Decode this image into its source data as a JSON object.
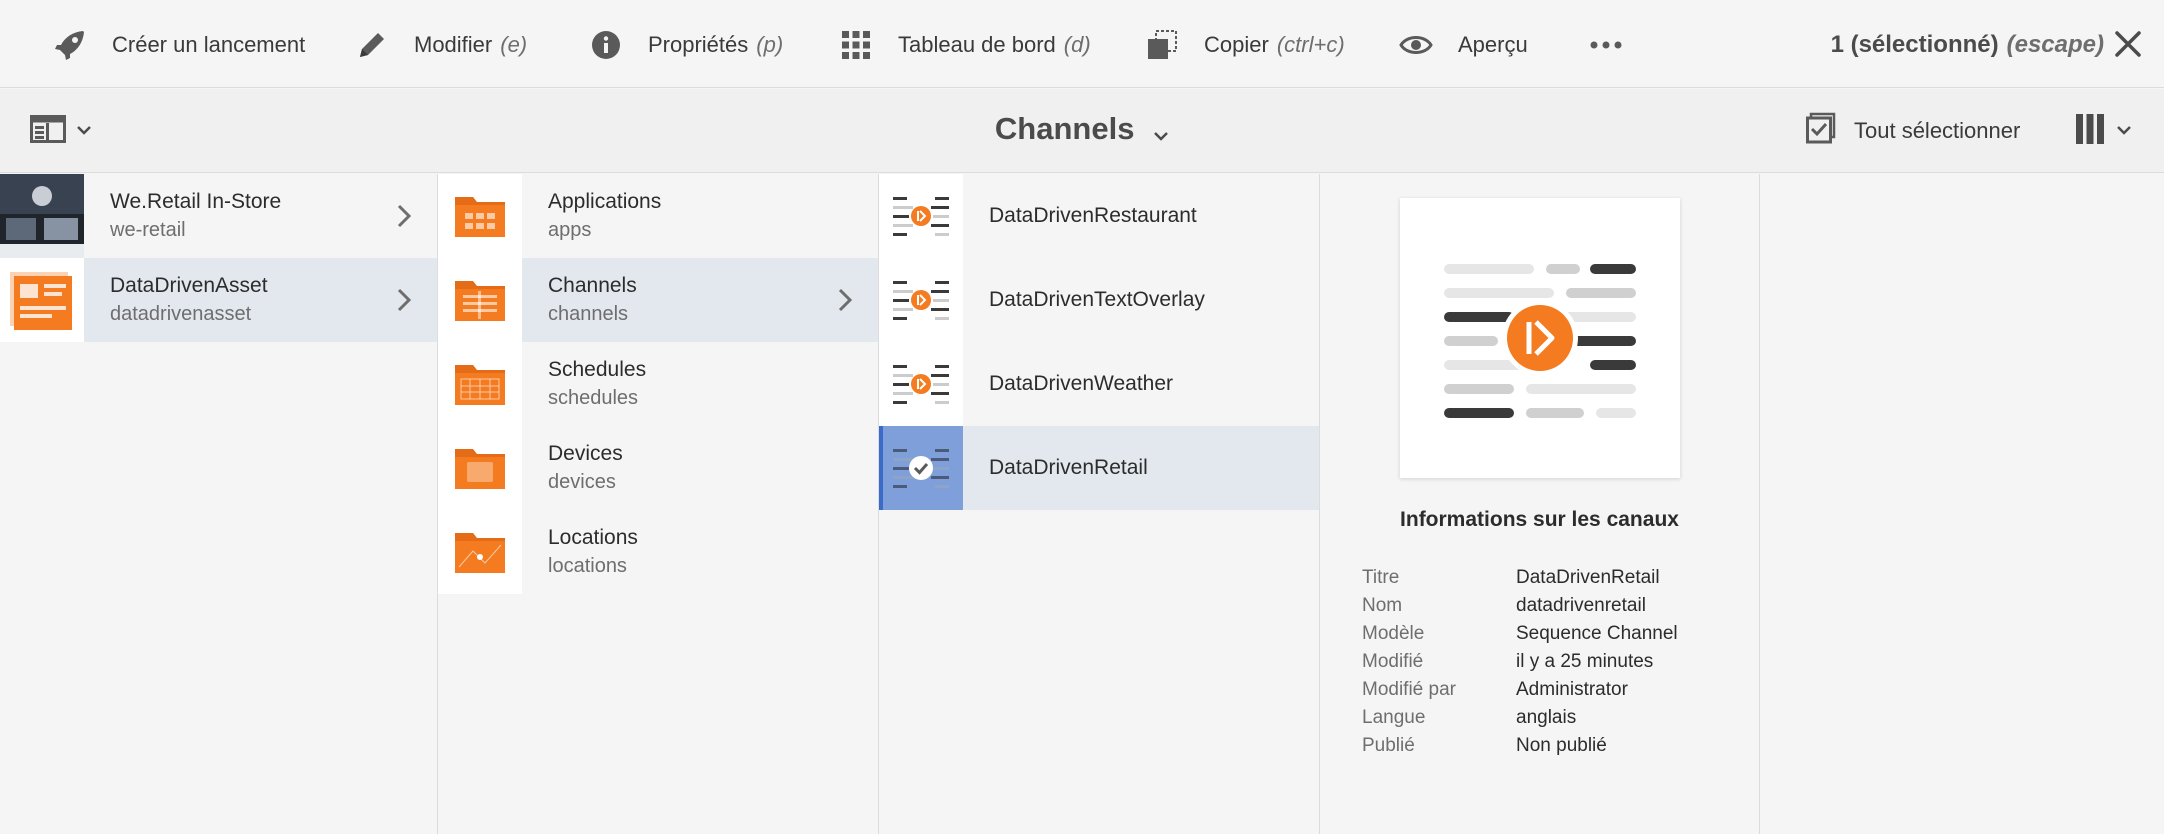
{
  "actionbar": {
    "actions": [
      {
        "label": "Créer un lancement",
        "shortcut": "",
        "icon": "rocket-icon"
      },
      {
        "label": "Modifier",
        "shortcut": "(e)",
        "icon": "pencil-icon"
      },
      {
        "label": "Propriétés",
        "shortcut": "(p)",
        "icon": "info-icon"
      },
      {
        "label": "Tableau de bord",
        "shortcut": "(d)",
        "icon": "grid-icon"
      },
      {
        "label": "Copier",
        "shortcut": "(ctrl+c)",
        "icon": "copy-icon"
      },
      {
        "label": "Aperçu",
        "shortcut": "",
        "icon": "eye-icon"
      }
    ],
    "more_icon": "more-icon",
    "selection_count": "1 (sélectionné)",
    "selection_shortcut": "(escape)"
  },
  "titlebar": {
    "title": "Channels",
    "select_all": "Tout sélectionner"
  },
  "column1": [
    {
      "title": "We.Retail In-Store",
      "subtitle": "we-retail"
    },
    {
      "title": "DataDrivenAsset",
      "subtitle": "datadrivenasset"
    }
  ],
  "column2": [
    {
      "title": "Applications",
      "subtitle": "apps"
    },
    {
      "title": "Channels",
      "subtitle": "channels"
    },
    {
      "title": "Schedules",
      "subtitle": "schedules"
    },
    {
      "title": "Devices",
      "subtitle": "devices"
    },
    {
      "title": "Locations",
      "subtitle": "locations"
    }
  ],
  "column3": [
    {
      "title": "DataDrivenRestaurant"
    },
    {
      "title": "DataDrivenTextOverlay"
    },
    {
      "title": "DataDrivenWeather"
    },
    {
      "title": "DataDrivenRetail"
    }
  ],
  "preview": {
    "heading": "Informations sur les canaux",
    "meta": [
      {
        "key": "Titre",
        "value": "DataDrivenRetail"
      },
      {
        "key": "Nom",
        "value": "datadrivenretail"
      },
      {
        "key": "Modèle",
        "value": "Sequence Channel"
      },
      {
        "key": "Modifié",
        "value": "il y a 25 minutes"
      },
      {
        "key": "Modifié par",
        "value": "Administrator"
      },
      {
        "key": "Langue",
        "value": "anglais"
      },
      {
        "key": "Publié",
        "value": "Non publié"
      }
    ]
  },
  "colors": {
    "accent": "#f47b20",
    "selected_row": "#e3e8ef",
    "selection_blue": "#3a6bc8"
  }
}
